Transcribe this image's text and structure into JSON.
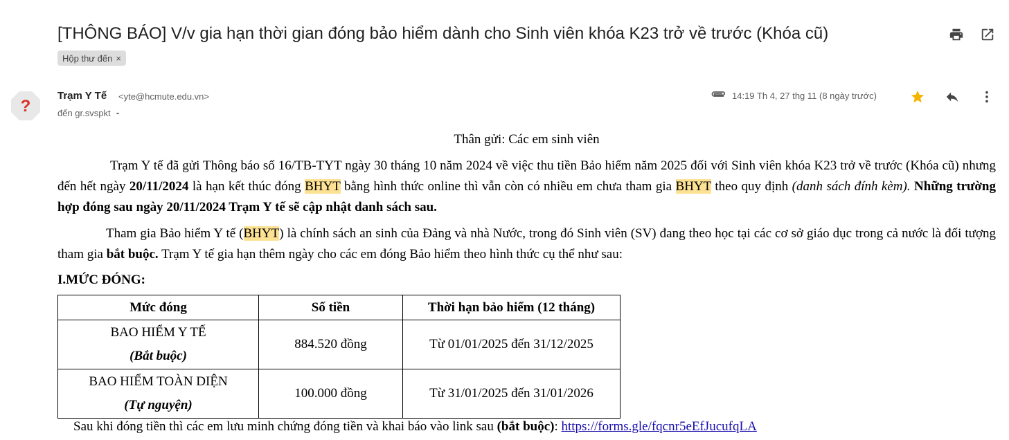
{
  "email": {
    "subject": "[THÔNG BÁO] V/v gia hạn thời gian đóng bảo hiểm dành cho Sinh viên khóa K23 trở về trước (Khóa cũ)",
    "label_chip": "Hộp thư đến",
    "label_remove": "×",
    "sender_name": "Trạm Y Tế",
    "sender_email": "<yte@hcmute.edu.vn>",
    "to_line": "đến gr.svspkt",
    "timestamp": "14:19 Th 4, 27 thg 11 (8 ngày trước)",
    "avatar_glyph": "?"
  },
  "icons": {
    "print": "print-icon",
    "popout": "open-in-new-icon",
    "attachment": "attachment-icon",
    "star": "star-icon",
    "reply": "reply-icon",
    "more": "more-vert-icon",
    "star_color": "#f4b400"
  },
  "body": {
    "greeting": "Thân gửi:  Các em sinh viên",
    "para1": {
      "t1": "Trạm Y tế đã gửi Thông báo số 16/TB-TYT ngày 30 tháng 10 năm 2024 về việc thu tiền Bảo hiểm năm 2025 đối với Sinh viên khóa K23 trở về trước (Khóa cũ) nhưng đến hết ngày ",
      "date_bold": "20/11/2024",
      "t2": " là hạn kết thúc đóng ",
      "bhyt1": "BHYT",
      "t3": " bằng hình thức online thì vẫn còn có nhiều em chưa tham gia ",
      "bhyt2": "BHYT",
      "t4": " theo quy định ",
      "italic": "(danh sách đính kèm).",
      "t5": " ",
      "bold_end": "Những trường hợp đóng sau ngày 20/11/2024 Trạm Y tế sẽ cập nhật danh sách sau."
    },
    "para2": {
      "t1": "Tham gia Bảo hiểm Y tế (",
      "bhyt": "BHYT",
      "t2": ") là chính sách an sinh của Đảng và nhà Nước, trong đó Sinh viên (SV) đang theo học tại các cơ sở giáo dục trong cả nước là đối tượng tham gia ",
      "bold": "bắt buộc.",
      "t3": " Trạm Y tế gia hạn thêm ngày cho các em đóng Bảo hiểm theo hình thức cụ thể như sau:"
    },
    "section_title": "I.MỨC ĐÓNG:",
    "table": {
      "headers": [
        "Mức đóng",
        "Số tiền",
        "Thời hạn bảo hiểm (12 tháng)"
      ],
      "rows": [
        {
          "name": "BAO HIỂM Y TẾ",
          "note": "(Bắt buộc)",
          "amount": "884.520 đồng",
          "period": "Từ 01/01/2025 đến 31/12/2025"
        },
        {
          "name": "BAO HIỂM TOÀN DIỆN",
          "note": "(Tự nguyện)",
          "amount": "100.000 đồng",
          "period": "Từ 31/01/2025 đến 31/01/2026"
        }
      ]
    },
    "final": {
      "t1": "Sau khi đóng tiền thì các em lưu minh chứng đóng tiền và khai báo vào link sau ",
      "bold": "(bắt buộc)",
      "t2": ": ",
      "link": "https://forms.gle/fqcnr5eEfJucufqLA"
    }
  }
}
